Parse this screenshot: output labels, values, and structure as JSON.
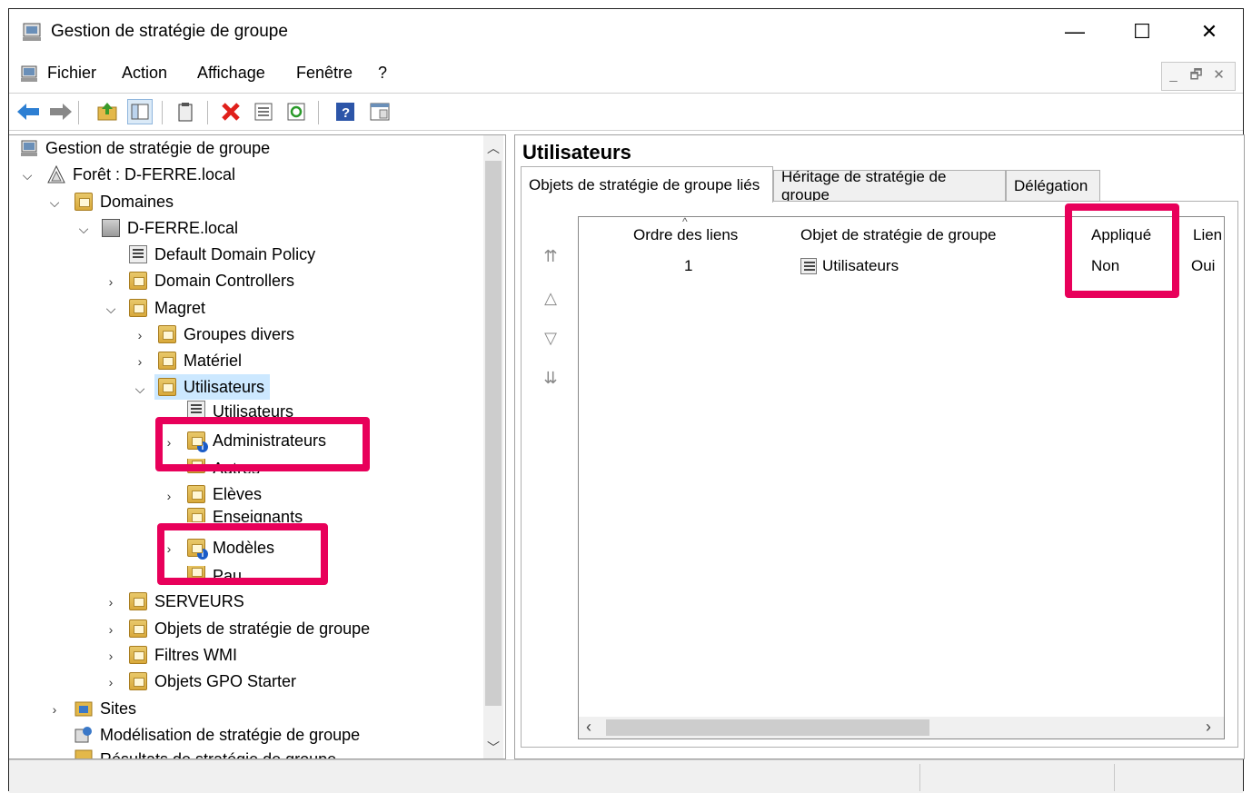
{
  "window": {
    "title": "Gestion de stratégie de groupe",
    "controls": {
      "minimize": "—",
      "maximize": "☐",
      "close": "✕"
    }
  },
  "menu": {
    "items": [
      "Fichier",
      "Action",
      "Affichage",
      "Fenêtre",
      "?"
    ]
  },
  "tree": {
    "root": "Gestion de stratégie de groupe",
    "forest": "Forêt : D-FERRE.local",
    "domains": "Domaines",
    "domain": "D-FERRE.local",
    "default_policy": "Default Domain Policy",
    "dc": "Domain Controllers",
    "magret": "Magret",
    "groupes": "Groupes divers",
    "materiel": "Matériel",
    "utilisateurs": "Utilisateurs",
    "utilisateurs_gpo": "Utilisateurs",
    "administrateurs": "Administrateurs",
    "autres": "Autres",
    "eleves": "Elèves",
    "enseignants": "Enseignants",
    "modeles": "Modèles",
    "pau": "Pau",
    "serveurs": "SERVEURS",
    "objets": "Objets de stratégie de groupe",
    "wmi": "Filtres WMI",
    "starter": "Objets GPO Starter",
    "sites": "Sites",
    "modelisation": "Modélisation de stratégie de groupe",
    "resultats": "Résultats de stratégie de groupe"
  },
  "details": {
    "title": "Utilisateurs",
    "tabs": [
      "Objets de stratégie de groupe liés",
      "Héritage de stratégie de groupe",
      "Délégation"
    ],
    "columns": [
      "Ordre des liens",
      "Objet de stratégie de groupe",
      "Appliqué",
      "Lien"
    ],
    "rows": [
      {
        "order": "1",
        "gpo": "Utilisateurs",
        "enforced": "Non",
        "link": "Oui"
      }
    ]
  },
  "colors": {
    "highlight": "#e8005a",
    "selection": "#cce8ff"
  }
}
